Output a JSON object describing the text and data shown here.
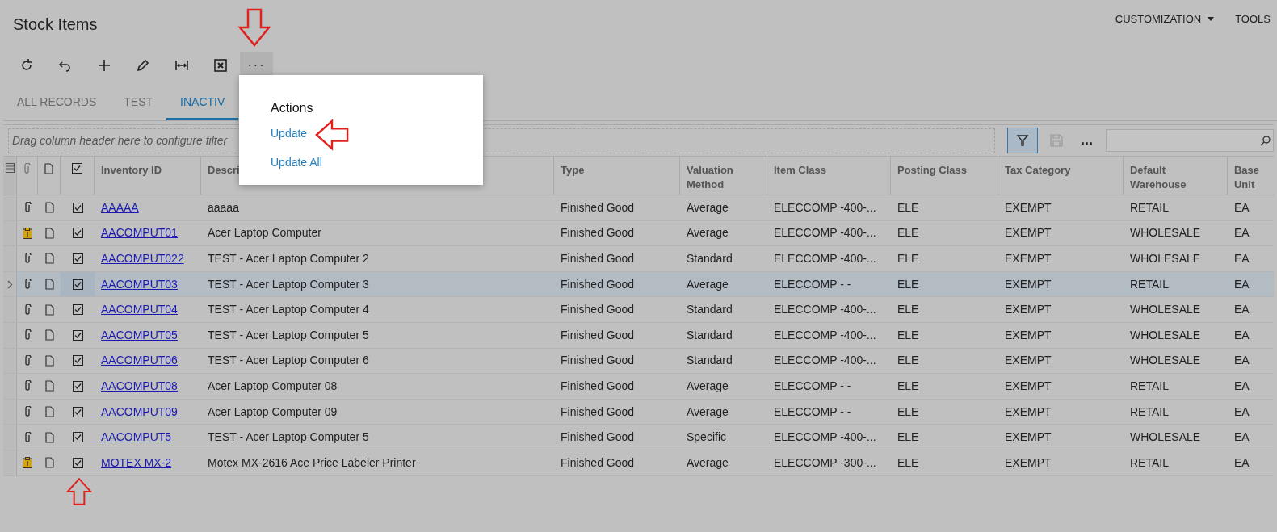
{
  "title": "Stock Items",
  "top_menu": [
    {
      "label": "CUSTOMIZATION"
    },
    {
      "label": "TOOLS"
    }
  ],
  "toolbar": [
    {
      "kind": "refresh"
    },
    {
      "kind": "undo"
    },
    {
      "kind": "add"
    },
    {
      "kind": "edit"
    },
    {
      "kind": "fit"
    },
    {
      "kind": "excel"
    },
    {
      "kind": "more",
      "label": "···",
      "active": true
    }
  ],
  "tabs": [
    {
      "label": "ALL RECORDS",
      "selected": false
    },
    {
      "label": "TEST",
      "selected": false
    },
    {
      "label": "INACTIV",
      "selected": true
    }
  ],
  "filter": {
    "placeholder": "Drag column header here to configure filter",
    "filter_active": true,
    "more": "..."
  },
  "actions_menu": {
    "title": "Actions",
    "items": [
      {
        "label": "Update"
      },
      {
        "label": "Update All"
      }
    ]
  },
  "table": {
    "columns": [
      "Inventory ID",
      "Descri",
      "Type",
      "Valuation Method",
      "Item Class",
      "Posting Class",
      "Tax Category",
      "Default Warehouse",
      "Base Unit"
    ],
    "rows": [
      {
        "selected": false,
        "kind": "clip",
        "cells": [
          "AAAAA",
          "aaaaa",
          "Finished Good",
          "Average",
          "ELECCOMP -400-...",
          "ELE",
          "EXEMPT",
          "RETAIL",
          "EA"
        ]
      },
      {
        "selected": false,
        "kind": "note",
        "cells": [
          "AACOMPUT01",
          "Acer Laptop Computer",
          "Finished Good",
          "Average",
          "ELECCOMP -400-...",
          "ELE",
          "EXEMPT",
          "WHOLESALE",
          "EA"
        ]
      },
      {
        "selected": false,
        "kind": "clip",
        "cells": [
          "AACOMPUT022",
          "TEST - Acer Laptop Computer 2",
          "Finished Good",
          "Standard",
          "ELECCOMP -400-...",
          "ELE",
          "EXEMPT",
          "WHOLESALE",
          "EA"
        ]
      },
      {
        "selected": true,
        "kind": "clip",
        "cells": [
          "AACOMPUT03",
          "TEST - Acer Laptop Computer 3",
          "Finished Good",
          "Average",
          "ELECCOMP - -",
          "ELE",
          "EXEMPT",
          "RETAIL",
          "EA"
        ]
      },
      {
        "selected": false,
        "kind": "clip",
        "cells": [
          "AACOMPUT04",
          "TEST - Acer Laptop Computer 4",
          "Finished Good",
          "Standard",
          "ELECCOMP -400-...",
          "ELE",
          "EXEMPT",
          "WHOLESALE",
          "EA"
        ]
      },
      {
        "selected": false,
        "kind": "clip",
        "cells": [
          "AACOMPUT05",
          "TEST - Acer Laptop Computer 5",
          "Finished Good",
          "Standard",
          "ELECCOMP -400-...",
          "ELE",
          "EXEMPT",
          "WHOLESALE",
          "EA"
        ]
      },
      {
        "selected": false,
        "kind": "clip",
        "cells": [
          "AACOMPUT06",
          "TEST - Acer Laptop Computer 6",
          "Finished Good",
          "Standard",
          "ELECCOMP -400-...",
          "ELE",
          "EXEMPT",
          "WHOLESALE",
          "EA"
        ]
      },
      {
        "selected": false,
        "kind": "clip",
        "cells": [
          "AACOMPUT08",
          "Acer Laptop Computer 08",
          "Finished Good",
          "Average",
          "ELECCOMP - -",
          "ELE",
          "EXEMPT",
          "RETAIL",
          "EA"
        ]
      },
      {
        "selected": false,
        "kind": "clip",
        "cells": [
          "AACOMPUT09",
          "Acer Laptop Computer 09",
          "Finished Good",
          "Average",
          "ELECCOMP - -",
          "ELE",
          "EXEMPT",
          "RETAIL",
          "EA"
        ]
      },
      {
        "selected": false,
        "kind": "clip",
        "cells": [
          "AACOMPUT5",
          "TEST - Acer Laptop Computer 5",
          "Finished Good",
          "Specific",
          "ELECCOMP -400-...",
          "ELE",
          "EXEMPT",
          "WHOLESALE",
          "EA"
        ]
      },
      {
        "selected": false,
        "kind": "note",
        "cells": [
          "MOTEX MX-2",
          "Motex MX-2616 Ace Price Labeler Printer",
          "Finished Good",
          "Average",
          "ELECCOMP -300-...",
          "ELE",
          "EXEMPT",
          "RETAIL",
          "EA"
        ]
      }
    ]
  }
}
